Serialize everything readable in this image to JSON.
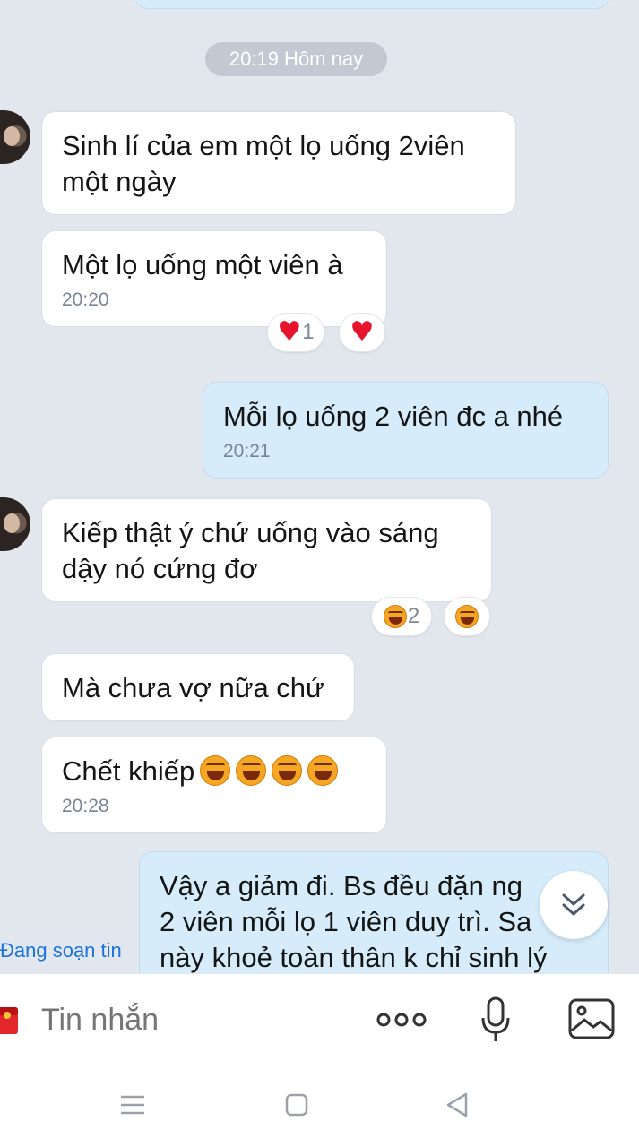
{
  "date_divider": "20:19 Hôm nay",
  "messages": [
    {
      "side": "in",
      "text": "Sinh lí của em một lọ uống 2viên một ngày",
      "time": ""
    },
    {
      "side": "in",
      "text": "Một lọ uống một viên à",
      "time": "20:20",
      "reactions": {
        "count": "1"
      }
    },
    {
      "side": "out",
      "text": "Mỗi lọ uống 2 viên đc a nhé",
      "time": "20:21"
    },
    {
      "side": "in",
      "text": "Kiếp thật ý chứ uống vào sáng dậy nó cứng đơ",
      "time": "",
      "reactions": {
        "count": "2"
      }
    },
    {
      "side": "in",
      "text": "Mà chưa vợ nữa chứ",
      "time": ""
    },
    {
      "side": "in",
      "text": "Chết khiếp",
      "time": "20:28",
      "emoji": "laugh-crying x4"
    },
    {
      "side": "out",
      "text_lines": [
        "Vậy a giảm đi. Bs đều đặn ng",
        "2 viên mỗi lọ 1 viên duy trì. Sa",
        "này khoẻ toàn thân k chỉ sinh lý"
      ],
      "time": ""
    }
  ],
  "typing_indicator": "Đang soạn tin",
  "composer": {
    "placeholder": "Tin nhắn"
  },
  "colors": {
    "outgoing_bubble": "#d6ecfb",
    "incoming_bubble": "#ffffff",
    "background": "#e2e7ee",
    "heart": "#e8132d",
    "typing_text": "#1a73d9"
  },
  "icons": [
    "sticker-icon",
    "more-icon",
    "mic-icon",
    "image-icon",
    "scroll-down-icon",
    "nav-menu-icon",
    "nav-home-icon",
    "nav-back-icon"
  ]
}
